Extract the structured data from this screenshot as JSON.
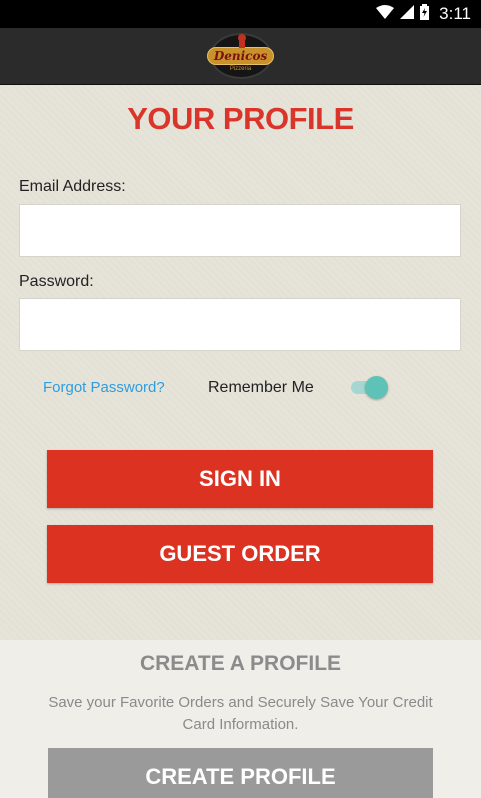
{
  "status_bar": {
    "time": "3:11",
    "icons": [
      "wifi-icon",
      "signal-icon",
      "battery-charging-icon"
    ]
  },
  "app_bar": {
    "logo_text": "Denicos",
    "logo_subtext": "Pizzeria"
  },
  "colors": {
    "accent_red": "#dc3222",
    "title_red": "#d9352a",
    "link_blue": "#2d9ee0",
    "toggle_teal": "#5ec2b7",
    "disabled_gray": "#9a9a9a"
  },
  "login": {
    "title": "YOUR PROFILE",
    "email_label": "Email Address:",
    "email_value": "",
    "password_label": "Password:",
    "password_value": "",
    "forgot_password": "Forgot Password?",
    "remember_me_label": "Remember Me",
    "remember_me_on": true,
    "sign_in_label": "SIGN IN",
    "guest_order_label": "GUEST ORDER"
  },
  "create_profile": {
    "title": "CREATE A PROFILE",
    "description": "Save your Favorite Orders and Securely Save Your Credit Card Information.",
    "button_label": "CREATE PROFILE"
  }
}
